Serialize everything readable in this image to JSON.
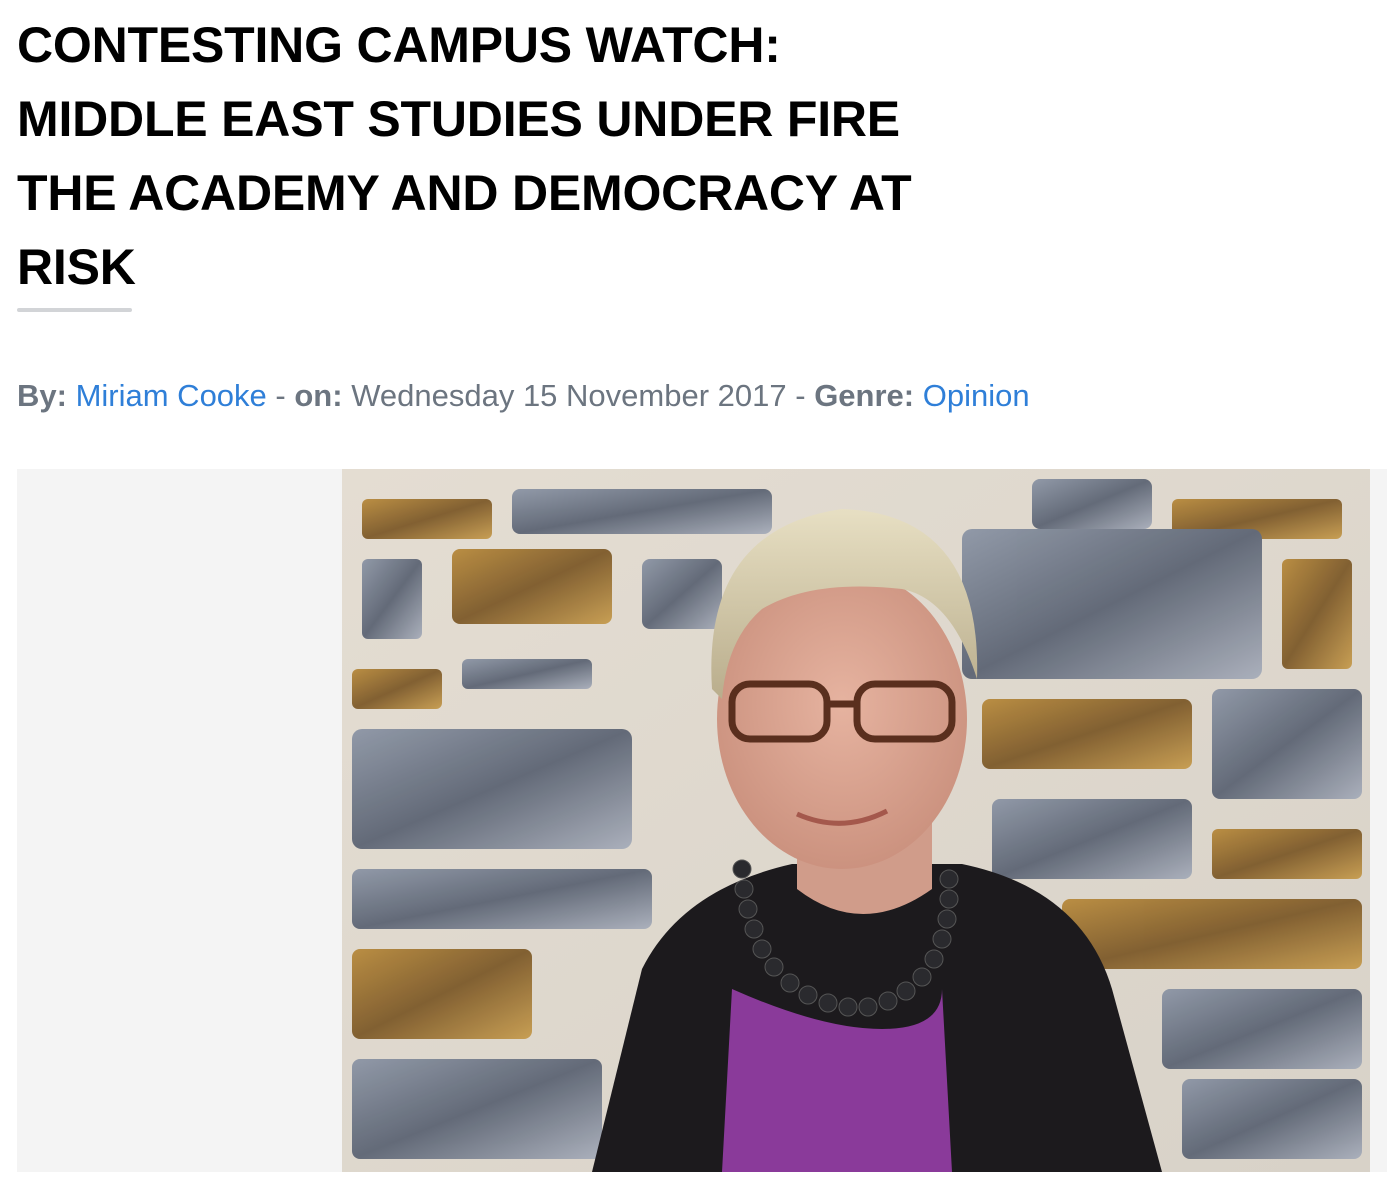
{
  "article": {
    "title_lines": [
      "CONTESTING CAMPUS WATCH:",
      "MIDDLE EAST STUDIES UNDER FIRE",
      "THE ACADEMY AND DEMOCRACY AT",
      "RISK"
    ],
    "meta": {
      "by_label": "By:",
      "author": "Miriam Cooke",
      "sep1": " - ",
      "on_label": "on:",
      "date": "Wednesday 15 November 2017",
      "sep2": " - ",
      "genre_label": "Genre:",
      "genre": "Opinion"
    }
  },
  "colors": {
    "link": "#2f7fd8",
    "meta_text": "#6c7580",
    "title": "#000000",
    "figure_bg": "#f4f4f4"
  }
}
